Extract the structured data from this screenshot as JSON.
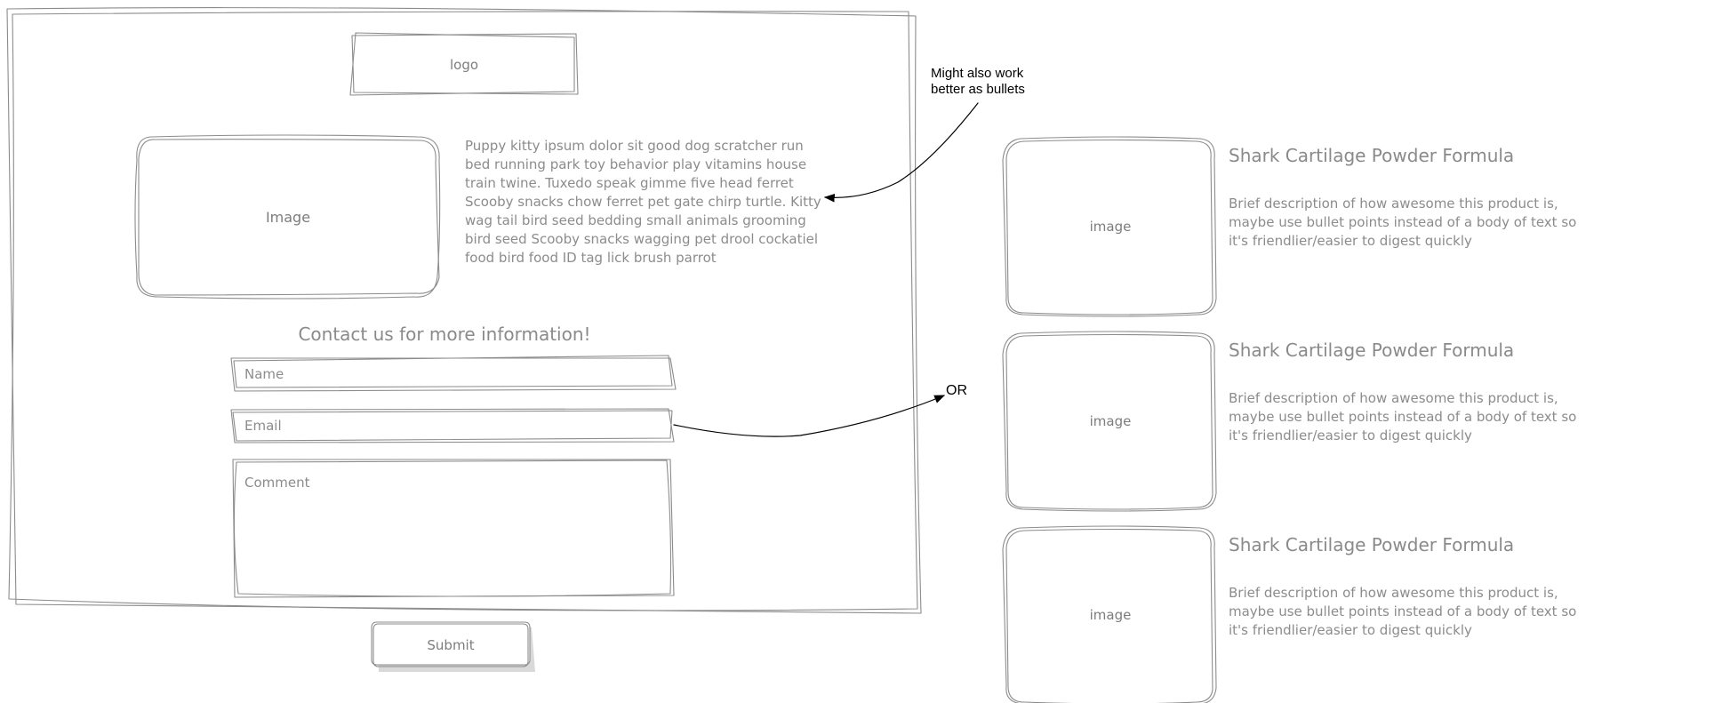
{
  "logo_label": "logo",
  "hero_image_label": "Image",
  "intro_text": "Puppy kitty ipsum dolor sit good dog scratcher run bed running park toy behavior play vitamins house train twine. Tuxedo speak gimme five head ferret Scooby snacks chow ferret pet gate chirp turtle. Kitty wag tail bird seed bedding small animals grooming bird seed Scooby snacks wagging pet drool cockatiel food bird food ID tag lick brush parrot",
  "contact": {
    "heading": "Contact us for more information!",
    "name_placeholder": "Name",
    "email_placeholder": "Email",
    "comment_placeholder": "Comment",
    "submit_label": "Submit"
  },
  "annotations": {
    "bullets_note_line1": "Might also work",
    "bullets_note_line2": "better as bullets",
    "or_note": "OR"
  },
  "products": [
    {
      "image_label": "image",
      "title": "Shark Cartilage Powder Formula",
      "description": "Brief description of how awesome this product is, maybe use bullet points instead of a body of text so it's friendlier/easier to digest quickly"
    },
    {
      "image_label": "image",
      "title": "Shark Cartilage Powder Formula",
      "description": "Brief description of how awesome this product is, maybe use bullet points instead of a body of text so it's friendlier/easier to digest quickly"
    },
    {
      "image_label": "image",
      "title": "Shark Cartilage Powder Formula",
      "description": "Brief description of how awesome this product is, maybe use bullet points instead of a body of text so it's friendlier/easier to digest quickly"
    }
  ]
}
